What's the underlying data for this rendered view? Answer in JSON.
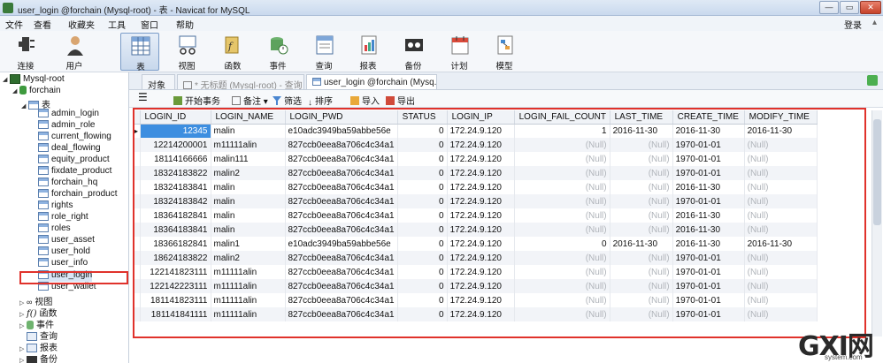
{
  "window": {
    "title": "user_login @forchain (Mysql-root) - 表 - Navicat for MySQL",
    "min_glyph": "—",
    "max_glyph": "▭",
    "close_glyph": "✕"
  },
  "menu": {
    "items": [
      "文件",
      "查看",
      "收藏夹",
      "工具",
      "窗口",
      "帮助"
    ],
    "login_label": "登录"
  },
  "toolbar": {
    "buttons": [
      {
        "label": "连接",
        "icon": "connect-icon"
      },
      {
        "label": "用户",
        "icon": "user-icon"
      },
      {
        "label": "表",
        "icon": "table-icon"
      },
      {
        "label": "视图",
        "icon": "view-icon"
      },
      {
        "label": "函数",
        "icon": "function-icon"
      },
      {
        "label": "事件",
        "icon": "event-icon"
      },
      {
        "label": "查询",
        "icon": "query-icon"
      },
      {
        "label": "报表",
        "icon": "report-icon"
      },
      {
        "label": "备份",
        "icon": "backup-icon"
      },
      {
        "label": "计划",
        "icon": "schedule-icon"
      },
      {
        "label": "模型",
        "icon": "model-icon"
      }
    ],
    "active": "表"
  },
  "sidebar": {
    "connection": "Mysql-root",
    "database": "forchain",
    "tables_label": "表",
    "tables": [
      "admin_login",
      "admin_role",
      "current_flowing",
      "deal_flowing",
      "equity_product",
      "fixdate_product",
      "forchain_hq",
      "forchain_product",
      "rights",
      "role_right",
      "roles",
      "user_asset",
      "user_hold",
      "user_info",
      "user_login",
      "user_wallet"
    ],
    "selected_table": "user_login",
    "groups": [
      {
        "label": "视图",
        "icon": "view-icon"
      },
      {
        "label": "函数",
        "icon": "function-icon"
      },
      {
        "label": "事件",
        "icon": "event-icon"
      },
      {
        "label": "查询",
        "icon": "query-icon"
      },
      {
        "label": "报表",
        "icon": "report-icon"
      },
      {
        "label": "备份",
        "icon": "backup-icon"
      }
    ]
  },
  "tabs": [
    {
      "label": "对象"
    },
    {
      "label": "* 无标题 (Mysql-root) - 查询"
    },
    {
      "label": "user_login @forchain (Mysq..."
    }
  ],
  "subtoolbar": {
    "menu_glyph": "☰",
    "begin_transaction": "开始事务",
    "note": "备注",
    "filter": "筛选",
    "sort": "排序",
    "import": "导入",
    "export": "导出"
  },
  "grid": {
    "columns": [
      "LOGIN_ID",
      "LOGIN_NAME",
      "LOGIN_PWD",
      "STATUS",
      "LOGIN_IP",
      "LOGIN_FAIL_COUNT",
      "LAST_TIME",
      "CREATE_TIME",
      "MODIFY_TIME"
    ],
    "rows": [
      [
        "12345",
        "malin",
        "e10adc3949ba59abbe56e",
        "0",
        "172.24.9.120",
        "1",
        "2016-11-30",
        "2016-11-30",
        "2016-11-30"
      ],
      [
        "12214200001",
        "m11111alin",
        "827ccb0eea8a706c4c34a1",
        "0",
        "172.24.9.120",
        "(Null)",
        "(Null)",
        "1970-01-01",
        "(Null)"
      ],
      [
        "18114166666",
        "malin111",
        "827ccb0eea8a706c4c34a1",
        "0",
        "172.24.9.120",
        "(Null)",
        "(Null)",
        "1970-01-01",
        "(Null)"
      ],
      [
        "18324183822",
        "malin2",
        "827ccb0eea8a706c4c34a1",
        "0",
        "172.24.9.120",
        "(Null)",
        "(Null)",
        "1970-01-01",
        "(Null)"
      ],
      [
        "18324183841",
        "malin",
        "827ccb0eea8a706c4c34a1",
        "0",
        "172.24.9.120",
        "(Null)",
        "(Null)",
        "2016-11-30",
        "(Null)"
      ],
      [
        "18324183842",
        "malin",
        "827ccb0eea8a706c4c34a1",
        "0",
        "172.24.9.120",
        "(Null)",
        "(Null)",
        "1970-01-01",
        "(Null)"
      ],
      [
        "18364182841",
        "malin",
        "827ccb0eea8a706c4c34a1",
        "0",
        "172.24.9.120",
        "(Null)",
        "(Null)",
        "2016-11-30",
        "(Null)"
      ],
      [
        "18364183841",
        "malin",
        "827ccb0eea8a706c4c34a1",
        "0",
        "172.24.9.120",
        "(Null)",
        "(Null)",
        "2016-11-30",
        "(Null)"
      ],
      [
        "18366182841",
        "malin1",
        "e10adc3949ba59abbe56e",
        "0",
        "172.24.9.120",
        "0",
        "2016-11-30",
        "2016-11-30",
        "2016-11-30"
      ],
      [
        "18624183822",
        "malin2",
        "827ccb0eea8a706c4c34a1",
        "0",
        "172.24.9.120",
        "(Null)",
        "(Null)",
        "1970-01-01",
        "(Null)"
      ],
      [
        "122141823111",
        "m11111alin",
        "827ccb0eea8a706c4c34a1",
        "0",
        "172.24.9.120",
        "(Null)",
        "(Null)",
        "1970-01-01",
        "(Null)"
      ],
      [
        "122142223111",
        "m11111alin",
        "827ccb0eea8a706c4c34a1",
        "0",
        "172.24.9.120",
        "(Null)",
        "(Null)",
        "1970-01-01",
        "(Null)"
      ],
      [
        "181141823111",
        "m11111alin",
        "827ccb0eea8a706c4c34a1",
        "0",
        "172.24.9.120",
        "(Null)",
        "(Null)",
        "1970-01-01",
        "(Null)"
      ],
      [
        "181141841111",
        "m11111alin",
        "827ccb0eea8a706c4c34a1",
        "0",
        "172.24.9.120",
        "(Null)",
        "(Null)",
        "1970-01-01",
        "(Null)"
      ]
    ],
    "selected_row": 0
  },
  "watermark": {
    "big": "GXI网",
    "small": "system.com"
  },
  "colors": {
    "highlight_frame": "#e0322b",
    "selection": "#3d8ee0",
    "null_text": "#b0b4ba"
  }
}
